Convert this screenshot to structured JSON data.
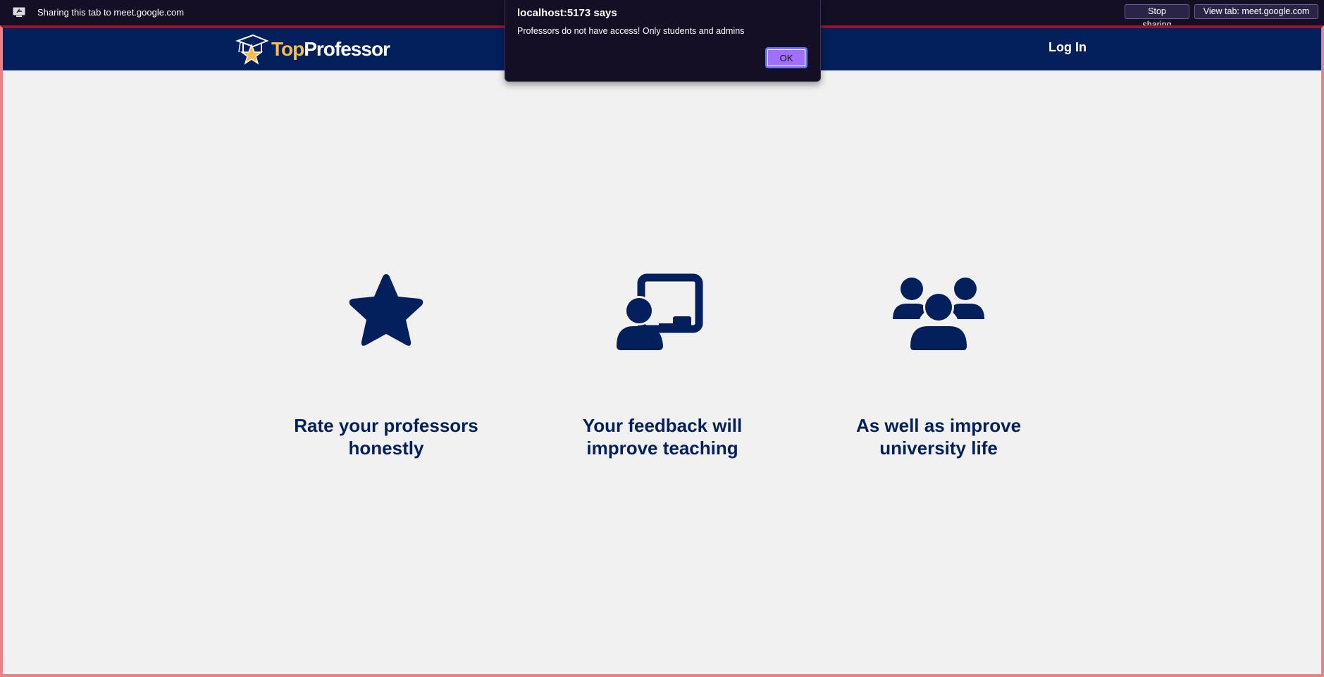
{
  "share_bar": {
    "text": "Sharing this tab to meet.google.com",
    "stop_label": "Stop sharing",
    "view_label": "View tab: meet.google.com",
    "icon": "screen-share-icon"
  },
  "header": {
    "logo_top": "Top",
    "logo_rest": "Professor",
    "login_label": "Log In"
  },
  "features": [
    {
      "icon": "star-icon",
      "text": "Rate your professors honestly"
    },
    {
      "icon": "teacher-board-icon",
      "text": "Your feedback will improve teaching"
    },
    {
      "icon": "people-group-icon",
      "text": "As well as improve university life"
    }
  ],
  "alert": {
    "title": "localhost:5173 says",
    "message": "Professors do not have access! Only students and admins",
    "ok_label": "OK"
  },
  "colors": {
    "navy": "#03205d",
    "accent_yellow": "#f8bd4c",
    "alert_bg": "#140f24",
    "ok_button": "#a070f8",
    "share_border": "#ef7f82"
  }
}
